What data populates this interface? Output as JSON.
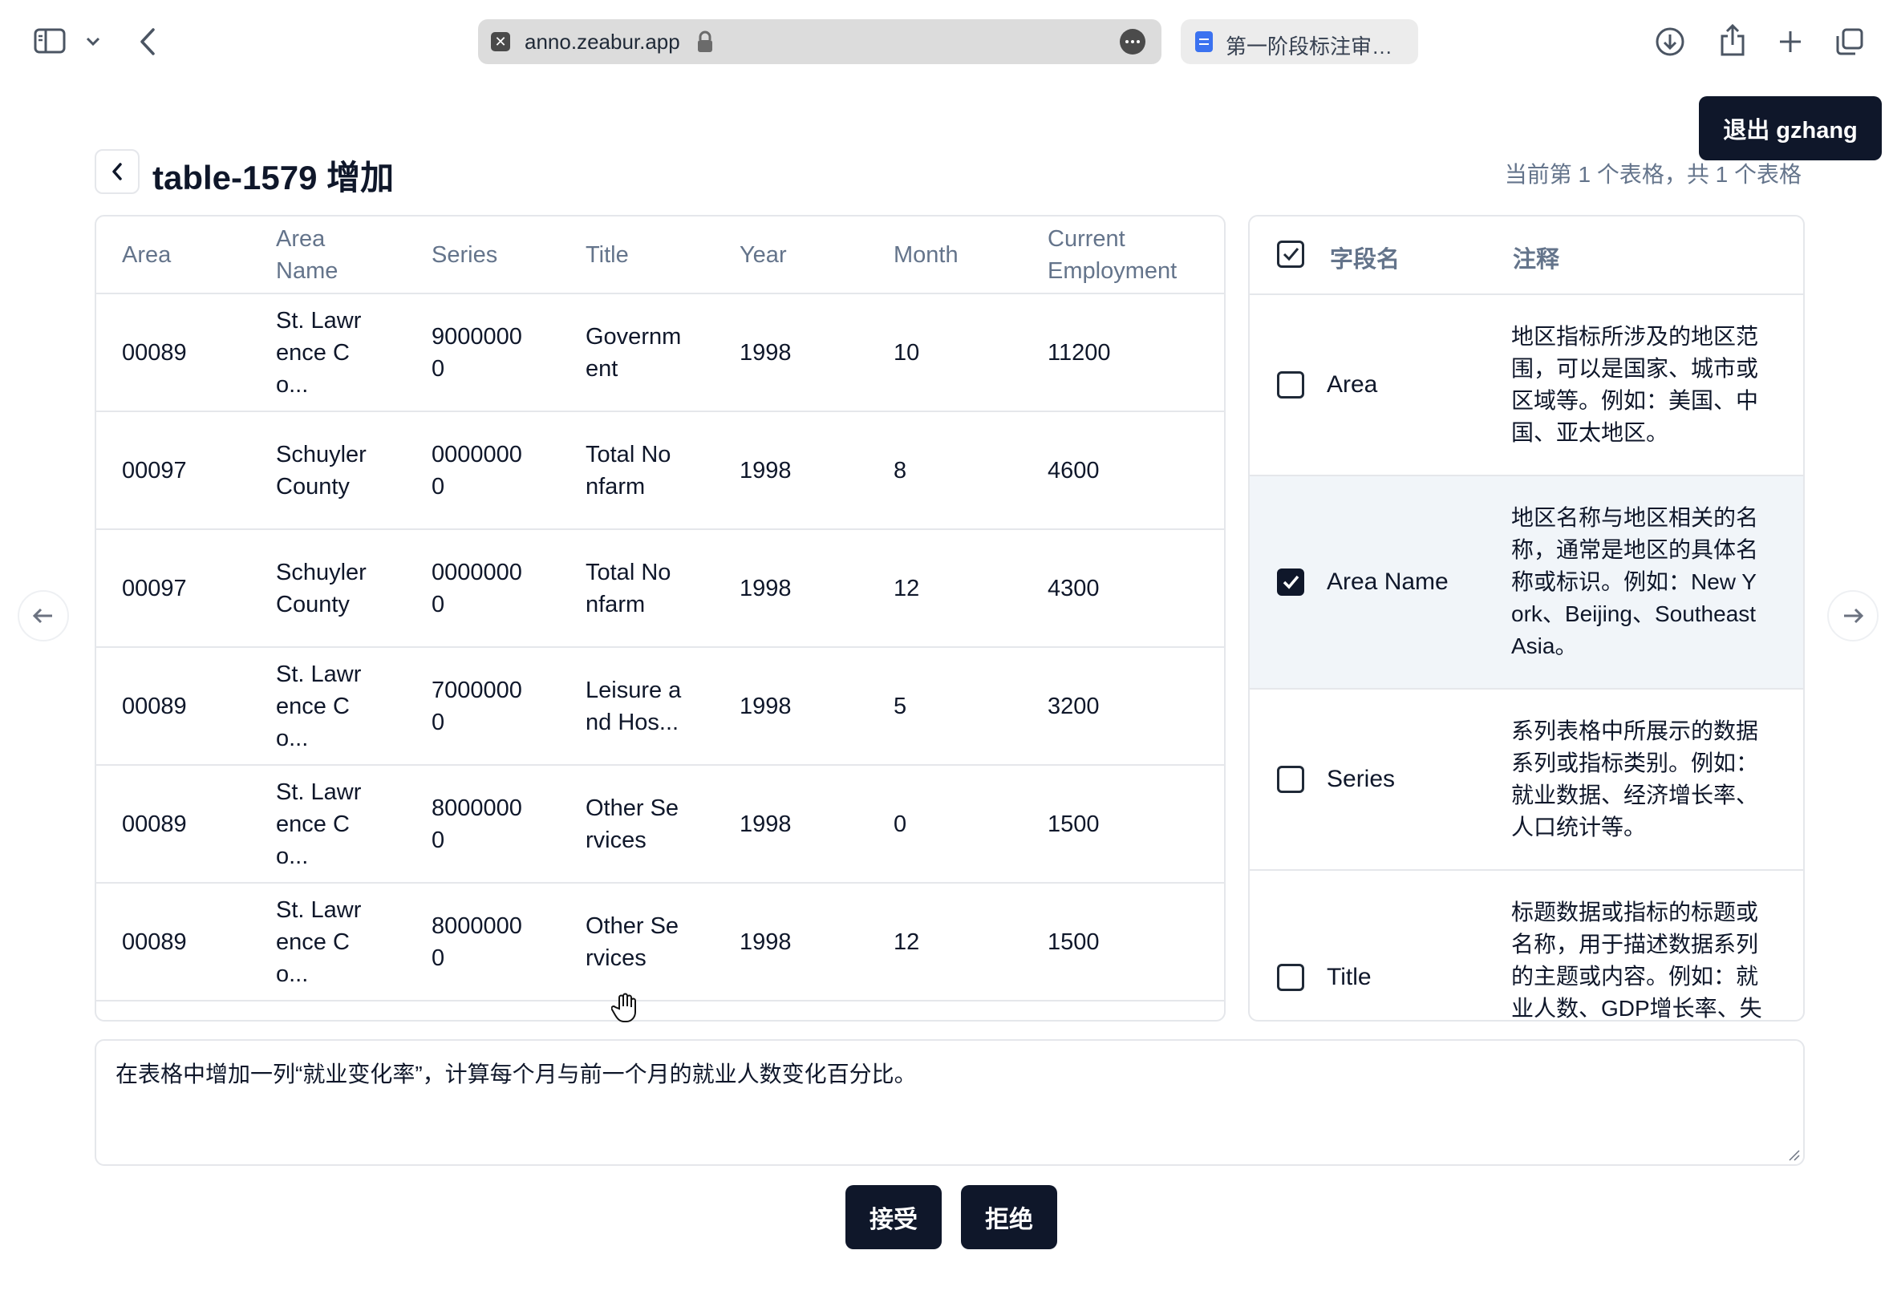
{
  "browser": {
    "url": "anno.zeabur.app",
    "second_tab_label": "第一阶段标注审…"
  },
  "header": {
    "logout_label": "退出 gzhang",
    "page_title": "table-1579 增加",
    "table_counter": "当前第 1 个表格，共 1 个表格"
  },
  "data_table": {
    "columns": [
      "Area",
      "Area Name",
      "Series",
      "Title",
      "Year",
      "Month",
      "Current Employment"
    ],
    "rows": [
      [
        "00089",
        "St. Lawrence Co...",
        "90000000",
        "Government",
        "1998",
        "10",
        "11200"
      ],
      [
        "00097",
        "Schuyler County",
        "00000000",
        "Total Nonfarm",
        "1998",
        "8",
        "4600"
      ],
      [
        "00097",
        "Schuyler County",
        "00000000",
        "Total Nonfarm",
        "1998",
        "12",
        "4300"
      ],
      [
        "00089",
        "St. Lawrence Co...",
        "70000000",
        "Leisure and Hos...",
        "1998",
        "5",
        "3200"
      ],
      [
        "00089",
        "St. Lawrence Co...",
        "80000000",
        "Other Services",
        "1998",
        "0",
        "1500"
      ],
      [
        "00089",
        "St. Lawrence Co...",
        "80000000",
        "Other Services",
        "1998",
        "12",
        "1500"
      ]
    ]
  },
  "fields_panel": {
    "header_field": "字段名",
    "header_note": "注释",
    "header_checked": true,
    "items": [
      {
        "name": "Area",
        "checked": false,
        "note": "地区指标所涉及的地区范围，可以是国家、城市或区域等。例如：美国、中国、亚太地区。"
      },
      {
        "name": "Area Name",
        "checked": true,
        "note": "地区名称与地区相关的名称，通常是地区的具体名称或标识。例如：New York、Beijing、Southeast Asia。"
      },
      {
        "name": "Series",
        "checked": false,
        "note": "系列表格中所展示的数据系列或指标类别。例如：就业数据、经济增长率、人口统计等。"
      },
      {
        "name": "Title",
        "checked": false,
        "note": "标题数据或指标的标题或名称，用于描述数据系列的主题或内容。例如：就业人数、GDP增长率、失"
      }
    ]
  },
  "instruction": {
    "text": "在表格中增加一列“就业变化率”，计算每个月与前一个月的就业人数变化百分比。"
  },
  "actions": {
    "accept_label": "接受",
    "reject_label": "拒绝"
  }
}
